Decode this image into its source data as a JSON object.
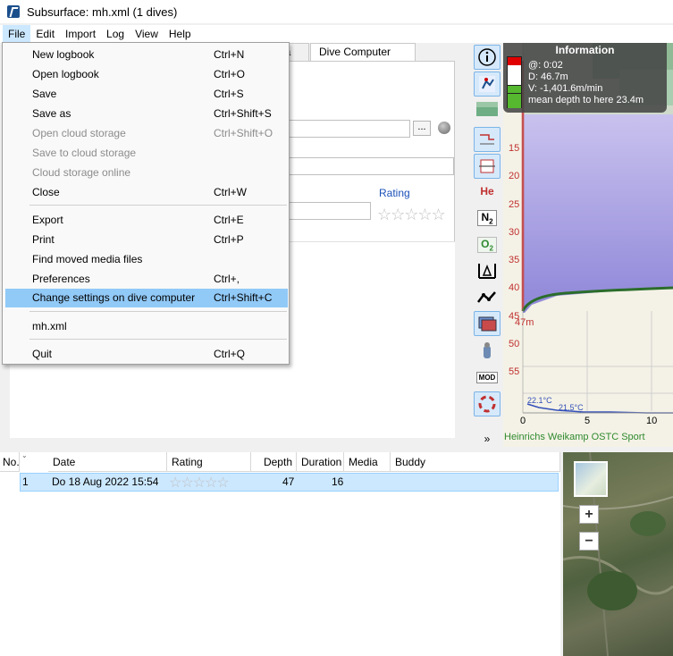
{
  "window": {
    "title": "Subsurface: mh.xml (1 dives)"
  },
  "menubar": [
    "File",
    "Edit",
    "Import",
    "Log",
    "View",
    "Help"
  ],
  "file_menu": {
    "items": [
      {
        "label": "New logbook",
        "shortcut": "Ctrl+N",
        "enabled": true
      },
      {
        "label": "Open logbook",
        "shortcut": "Ctrl+O",
        "enabled": true
      },
      {
        "label": "Save",
        "shortcut": "Ctrl+S",
        "enabled": true
      },
      {
        "label": "Save as",
        "shortcut": "Ctrl+Shift+S",
        "enabled": true
      },
      {
        "label": "Open cloud storage",
        "shortcut": "Ctrl+Shift+O",
        "enabled": false
      },
      {
        "label": "Save to cloud storage",
        "shortcut": "",
        "enabled": false
      },
      {
        "label": "Cloud storage online",
        "shortcut": "",
        "enabled": false
      },
      {
        "label": "Close",
        "shortcut": "Ctrl+W",
        "enabled": true
      },
      {
        "label": "Export",
        "shortcut": "Ctrl+E",
        "enabled": true
      },
      {
        "label": "Print",
        "shortcut": "Ctrl+P",
        "enabled": true
      },
      {
        "label": "Find moved media files",
        "shortcut": "",
        "enabled": true
      },
      {
        "label": "Preferences",
        "shortcut": "Ctrl+,",
        "enabled": true
      },
      {
        "label": "Change settings on dive computer",
        "shortcut": "Ctrl+Shift+C",
        "enabled": true,
        "highlighted": true
      },
      {
        "label": "mh.xml",
        "shortcut": "",
        "enabled": true
      },
      {
        "label": "Quit",
        "shortcut": "Ctrl+Q",
        "enabled": true
      }
    ]
  },
  "tabs": {
    "partial": "ia",
    "dive_computer_info": "Dive Computer Info"
  },
  "notes": {
    "rating_label": "Rating",
    "dots_button": "...",
    "stars": "☆☆☆☆☆"
  },
  "toolbar": {
    "he": "He",
    "n2": "N",
    "n2_sub": "2",
    "o2": "O",
    "o2_sub": "2",
    "mod": "MOD",
    "more": "»"
  },
  "profile": {
    "info": {
      "title": "Information",
      "time": "@: 0:02",
      "depth": "D: 46.7m",
      "velocity": "V: -1,401.6m/min",
      "mean": "mean depth to here 23.4m"
    },
    "depth_ticks": [
      "15",
      "20",
      "25",
      "30",
      "35",
      "40",
      "45",
      "50",
      "55"
    ],
    "time_ticks": [
      "0",
      "5",
      "10"
    ],
    "max_depth_label": "47m",
    "temp_labels": [
      "22.1°C",
      "21.5°C"
    ],
    "dive_computer": "Heinrichs Weikamp OSTC Sport"
  },
  "dive_list": {
    "columns": [
      "No.",
      "Date",
      "Rating",
      "Depth",
      "Duration",
      "Media",
      "Buddy"
    ],
    "rows": [
      {
        "no": "1",
        "date": "Do 18 Aug 2022 15:54",
        "rating": 0,
        "depth": "47",
        "duration": "16",
        "media": "",
        "buddy": ""
      }
    ]
  },
  "map": {
    "zoom_in": "+",
    "zoom_out": "−"
  },
  "colors": {
    "menu_highlight": "#91c9f7",
    "row_selected": "#cce8ff",
    "rating_link": "#1a50b8"
  }
}
